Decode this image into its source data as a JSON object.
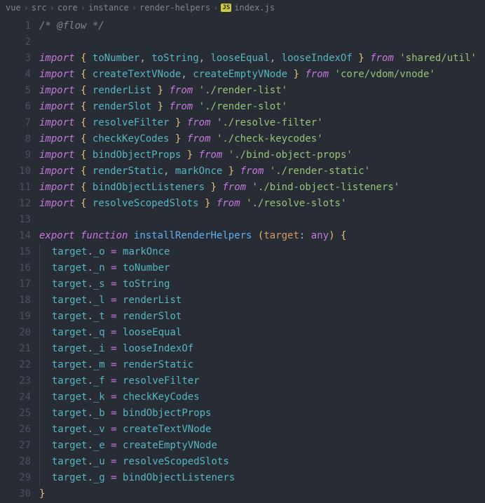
{
  "breadcrumb": {
    "items": [
      "vue",
      "src",
      "core",
      "instance",
      "render-helpers"
    ],
    "file_icon": "JS",
    "file_name": "index.js"
  },
  "code": {
    "lines": [
      {
        "n": 1,
        "t": [
          [
            "comment",
            "/* @flow */"
          ]
        ]
      },
      {
        "n": 2,
        "t": []
      },
      {
        "n": 3,
        "t": [
          [
            "keyword",
            "import"
          ],
          [
            "plain",
            " "
          ],
          [
            "punct",
            "{"
          ],
          [
            "plain",
            " "
          ],
          [
            "ident",
            "toNumber"
          ],
          [
            "plain",
            ", "
          ],
          [
            "ident",
            "toString"
          ],
          [
            "plain",
            ", "
          ],
          [
            "ident",
            "looseEqual"
          ],
          [
            "plain",
            ", "
          ],
          [
            "ident",
            "looseIndexOf"
          ],
          [
            "plain",
            " "
          ],
          [
            "punct",
            "}"
          ],
          [
            "plain",
            " "
          ],
          [
            "keyword",
            "from"
          ],
          [
            "plain",
            " "
          ],
          [
            "string",
            "'shared/util'"
          ]
        ]
      },
      {
        "n": 4,
        "t": [
          [
            "keyword",
            "import"
          ],
          [
            "plain",
            " "
          ],
          [
            "punct",
            "{"
          ],
          [
            "plain",
            " "
          ],
          [
            "ident",
            "createTextVNode"
          ],
          [
            "plain",
            ", "
          ],
          [
            "ident",
            "createEmptyVNode"
          ],
          [
            "plain",
            " "
          ],
          [
            "punct",
            "}"
          ],
          [
            "plain",
            " "
          ],
          [
            "keyword",
            "from"
          ],
          [
            "plain",
            " "
          ],
          [
            "string",
            "'core/vdom/vnode'"
          ]
        ]
      },
      {
        "n": 5,
        "t": [
          [
            "keyword",
            "import"
          ],
          [
            "plain",
            " "
          ],
          [
            "punct",
            "{"
          ],
          [
            "plain",
            " "
          ],
          [
            "ident",
            "renderList"
          ],
          [
            "plain",
            " "
          ],
          [
            "punct",
            "}"
          ],
          [
            "plain",
            " "
          ],
          [
            "keyword",
            "from"
          ],
          [
            "plain",
            " "
          ],
          [
            "string",
            "'./render-list'"
          ]
        ]
      },
      {
        "n": 6,
        "t": [
          [
            "keyword",
            "import"
          ],
          [
            "plain",
            " "
          ],
          [
            "punct",
            "{"
          ],
          [
            "plain",
            " "
          ],
          [
            "ident",
            "renderSlot"
          ],
          [
            "plain",
            " "
          ],
          [
            "punct",
            "}"
          ],
          [
            "plain",
            " "
          ],
          [
            "keyword",
            "from"
          ],
          [
            "plain",
            " "
          ],
          [
            "string",
            "'./render-slot'"
          ]
        ]
      },
      {
        "n": 7,
        "t": [
          [
            "keyword",
            "import"
          ],
          [
            "plain",
            " "
          ],
          [
            "punct",
            "{"
          ],
          [
            "plain",
            " "
          ],
          [
            "ident",
            "resolveFilter"
          ],
          [
            "plain",
            " "
          ],
          [
            "punct",
            "}"
          ],
          [
            "plain",
            " "
          ],
          [
            "keyword",
            "from"
          ],
          [
            "plain",
            " "
          ],
          [
            "string",
            "'./resolve-filter'"
          ]
        ]
      },
      {
        "n": 8,
        "t": [
          [
            "keyword",
            "import"
          ],
          [
            "plain",
            " "
          ],
          [
            "punct",
            "{"
          ],
          [
            "plain",
            " "
          ],
          [
            "ident",
            "checkKeyCodes"
          ],
          [
            "plain",
            " "
          ],
          [
            "punct",
            "}"
          ],
          [
            "plain",
            " "
          ],
          [
            "keyword",
            "from"
          ],
          [
            "plain",
            " "
          ],
          [
            "string",
            "'./check-keycodes'"
          ]
        ]
      },
      {
        "n": 9,
        "t": [
          [
            "keyword",
            "import"
          ],
          [
            "plain",
            " "
          ],
          [
            "punct",
            "{"
          ],
          [
            "plain",
            " "
          ],
          [
            "ident",
            "bindObjectProps"
          ],
          [
            "plain",
            " "
          ],
          [
            "punct",
            "}"
          ],
          [
            "plain",
            " "
          ],
          [
            "keyword",
            "from"
          ],
          [
            "plain",
            " "
          ],
          [
            "string",
            "'./bind-object-props'"
          ]
        ]
      },
      {
        "n": 10,
        "t": [
          [
            "keyword",
            "import"
          ],
          [
            "plain",
            " "
          ],
          [
            "punct",
            "{"
          ],
          [
            "plain",
            " "
          ],
          [
            "ident",
            "renderStatic"
          ],
          [
            "plain",
            ", "
          ],
          [
            "ident",
            "markOnce"
          ],
          [
            "plain",
            " "
          ],
          [
            "punct",
            "}"
          ],
          [
            "plain",
            " "
          ],
          [
            "keyword",
            "from"
          ],
          [
            "plain",
            " "
          ],
          [
            "string",
            "'./render-static'"
          ]
        ]
      },
      {
        "n": 11,
        "t": [
          [
            "keyword",
            "import"
          ],
          [
            "plain",
            " "
          ],
          [
            "punct",
            "{"
          ],
          [
            "plain",
            " "
          ],
          [
            "ident",
            "bindObjectListeners"
          ],
          [
            "plain",
            " "
          ],
          [
            "punct",
            "}"
          ],
          [
            "plain",
            " "
          ],
          [
            "keyword",
            "from"
          ],
          [
            "plain",
            " "
          ],
          [
            "string",
            "'./bind-object-listeners'"
          ]
        ]
      },
      {
        "n": 12,
        "t": [
          [
            "keyword",
            "import"
          ],
          [
            "plain",
            " "
          ],
          [
            "punct",
            "{"
          ],
          [
            "plain",
            " "
          ],
          [
            "ident",
            "resolveScopedSlots"
          ],
          [
            "plain",
            " "
          ],
          [
            "punct",
            "}"
          ],
          [
            "plain",
            " "
          ],
          [
            "keyword",
            "from"
          ],
          [
            "plain",
            " "
          ],
          [
            "string",
            "'./resolve-slots'"
          ]
        ]
      },
      {
        "n": 13,
        "t": []
      },
      {
        "n": 14,
        "t": [
          [
            "keyword",
            "export"
          ],
          [
            "plain",
            " "
          ],
          [
            "keyword",
            "function"
          ],
          [
            "plain",
            " "
          ],
          [
            "funcname",
            "installRenderHelpers"
          ],
          [
            "plain",
            " "
          ],
          [
            "punct",
            "("
          ],
          [
            "param",
            "target"
          ],
          [
            "plain",
            ": "
          ],
          [
            "type",
            "any"
          ],
          [
            "punct",
            ")"
          ],
          [
            "plain",
            " "
          ],
          [
            "punct",
            "{"
          ]
        ]
      },
      {
        "n": 15,
        "indent": 1,
        "t": [
          [
            "plain",
            "  "
          ],
          [
            "ident",
            "target"
          ],
          [
            "plain",
            "."
          ],
          [
            "ident",
            "_o"
          ],
          [
            "plain",
            " "
          ],
          [
            "op",
            "="
          ],
          [
            "plain",
            " "
          ],
          [
            "ident",
            "markOnce"
          ]
        ]
      },
      {
        "n": 16,
        "indent": 1,
        "t": [
          [
            "plain",
            "  "
          ],
          [
            "ident",
            "target"
          ],
          [
            "plain",
            "."
          ],
          [
            "ident",
            "_n"
          ],
          [
            "plain",
            " "
          ],
          [
            "op",
            "="
          ],
          [
            "plain",
            " "
          ],
          [
            "ident",
            "toNumber"
          ]
        ]
      },
      {
        "n": 17,
        "indent": 1,
        "t": [
          [
            "plain",
            "  "
          ],
          [
            "ident",
            "target"
          ],
          [
            "plain",
            "."
          ],
          [
            "ident",
            "_s"
          ],
          [
            "plain",
            " "
          ],
          [
            "op",
            "="
          ],
          [
            "plain",
            " "
          ],
          [
            "ident",
            "toString"
          ]
        ]
      },
      {
        "n": 18,
        "indent": 1,
        "t": [
          [
            "plain",
            "  "
          ],
          [
            "ident",
            "target"
          ],
          [
            "plain",
            "."
          ],
          [
            "ident",
            "_l"
          ],
          [
            "plain",
            " "
          ],
          [
            "op",
            "="
          ],
          [
            "plain",
            " "
          ],
          [
            "ident",
            "renderList"
          ]
        ]
      },
      {
        "n": 19,
        "indent": 1,
        "t": [
          [
            "plain",
            "  "
          ],
          [
            "ident",
            "target"
          ],
          [
            "plain",
            "."
          ],
          [
            "ident",
            "_t"
          ],
          [
            "plain",
            " "
          ],
          [
            "op",
            "="
          ],
          [
            "plain",
            " "
          ],
          [
            "ident",
            "renderSlot"
          ]
        ]
      },
      {
        "n": 20,
        "indent": 1,
        "t": [
          [
            "plain",
            "  "
          ],
          [
            "ident",
            "target"
          ],
          [
            "plain",
            "."
          ],
          [
            "ident",
            "_q"
          ],
          [
            "plain",
            " "
          ],
          [
            "op",
            "="
          ],
          [
            "plain",
            " "
          ],
          [
            "ident",
            "looseEqual"
          ]
        ]
      },
      {
        "n": 21,
        "indent": 1,
        "t": [
          [
            "plain",
            "  "
          ],
          [
            "ident",
            "target"
          ],
          [
            "plain",
            "."
          ],
          [
            "ident",
            "_i"
          ],
          [
            "plain",
            " "
          ],
          [
            "op",
            "="
          ],
          [
            "plain",
            " "
          ],
          [
            "ident",
            "looseIndexOf"
          ]
        ]
      },
      {
        "n": 22,
        "indent": 1,
        "t": [
          [
            "plain",
            "  "
          ],
          [
            "ident",
            "target"
          ],
          [
            "plain",
            "."
          ],
          [
            "ident",
            "_m"
          ],
          [
            "plain",
            " "
          ],
          [
            "op",
            "="
          ],
          [
            "plain",
            " "
          ],
          [
            "ident",
            "renderStatic"
          ]
        ]
      },
      {
        "n": 23,
        "indent": 1,
        "t": [
          [
            "plain",
            "  "
          ],
          [
            "ident",
            "target"
          ],
          [
            "plain",
            "."
          ],
          [
            "ident",
            "_f"
          ],
          [
            "plain",
            " "
          ],
          [
            "op",
            "="
          ],
          [
            "plain",
            " "
          ],
          [
            "ident",
            "resolveFilter"
          ]
        ]
      },
      {
        "n": 24,
        "indent": 1,
        "t": [
          [
            "plain",
            "  "
          ],
          [
            "ident",
            "target"
          ],
          [
            "plain",
            "."
          ],
          [
            "ident",
            "_k"
          ],
          [
            "plain",
            " "
          ],
          [
            "op",
            "="
          ],
          [
            "plain",
            " "
          ],
          [
            "ident",
            "checkKeyCodes"
          ]
        ]
      },
      {
        "n": 25,
        "indent": 1,
        "t": [
          [
            "plain",
            "  "
          ],
          [
            "ident",
            "target"
          ],
          [
            "plain",
            "."
          ],
          [
            "ident",
            "_b"
          ],
          [
            "plain",
            " "
          ],
          [
            "op",
            "="
          ],
          [
            "plain",
            " "
          ],
          [
            "ident",
            "bindObjectProps"
          ]
        ]
      },
      {
        "n": 26,
        "indent": 1,
        "t": [
          [
            "plain",
            "  "
          ],
          [
            "ident",
            "target"
          ],
          [
            "plain",
            "."
          ],
          [
            "ident",
            "_v"
          ],
          [
            "plain",
            " "
          ],
          [
            "op",
            "="
          ],
          [
            "plain",
            " "
          ],
          [
            "ident",
            "createTextVNode"
          ]
        ]
      },
      {
        "n": 27,
        "indent": 1,
        "t": [
          [
            "plain",
            "  "
          ],
          [
            "ident",
            "target"
          ],
          [
            "plain",
            "."
          ],
          [
            "ident",
            "_e"
          ],
          [
            "plain",
            " "
          ],
          [
            "op",
            "="
          ],
          [
            "plain",
            " "
          ],
          [
            "ident",
            "createEmptyVNode"
          ]
        ]
      },
      {
        "n": 28,
        "indent": 1,
        "t": [
          [
            "plain",
            "  "
          ],
          [
            "ident",
            "target"
          ],
          [
            "plain",
            "."
          ],
          [
            "ident",
            "_u"
          ],
          [
            "plain",
            " "
          ],
          [
            "op",
            "="
          ],
          [
            "plain",
            " "
          ],
          [
            "ident",
            "resolveScopedSlots"
          ]
        ]
      },
      {
        "n": 29,
        "indent": 1,
        "t": [
          [
            "plain",
            "  "
          ],
          [
            "ident",
            "target"
          ],
          [
            "plain",
            "."
          ],
          [
            "ident",
            "_g"
          ],
          [
            "plain",
            " "
          ],
          [
            "op",
            "="
          ],
          [
            "plain",
            " "
          ],
          [
            "ident",
            "bindObjectListeners"
          ]
        ]
      },
      {
        "n": 30,
        "t": [
          [
            "punct",
            "}"
          ]
        ]
      }
    ]
  }
}
